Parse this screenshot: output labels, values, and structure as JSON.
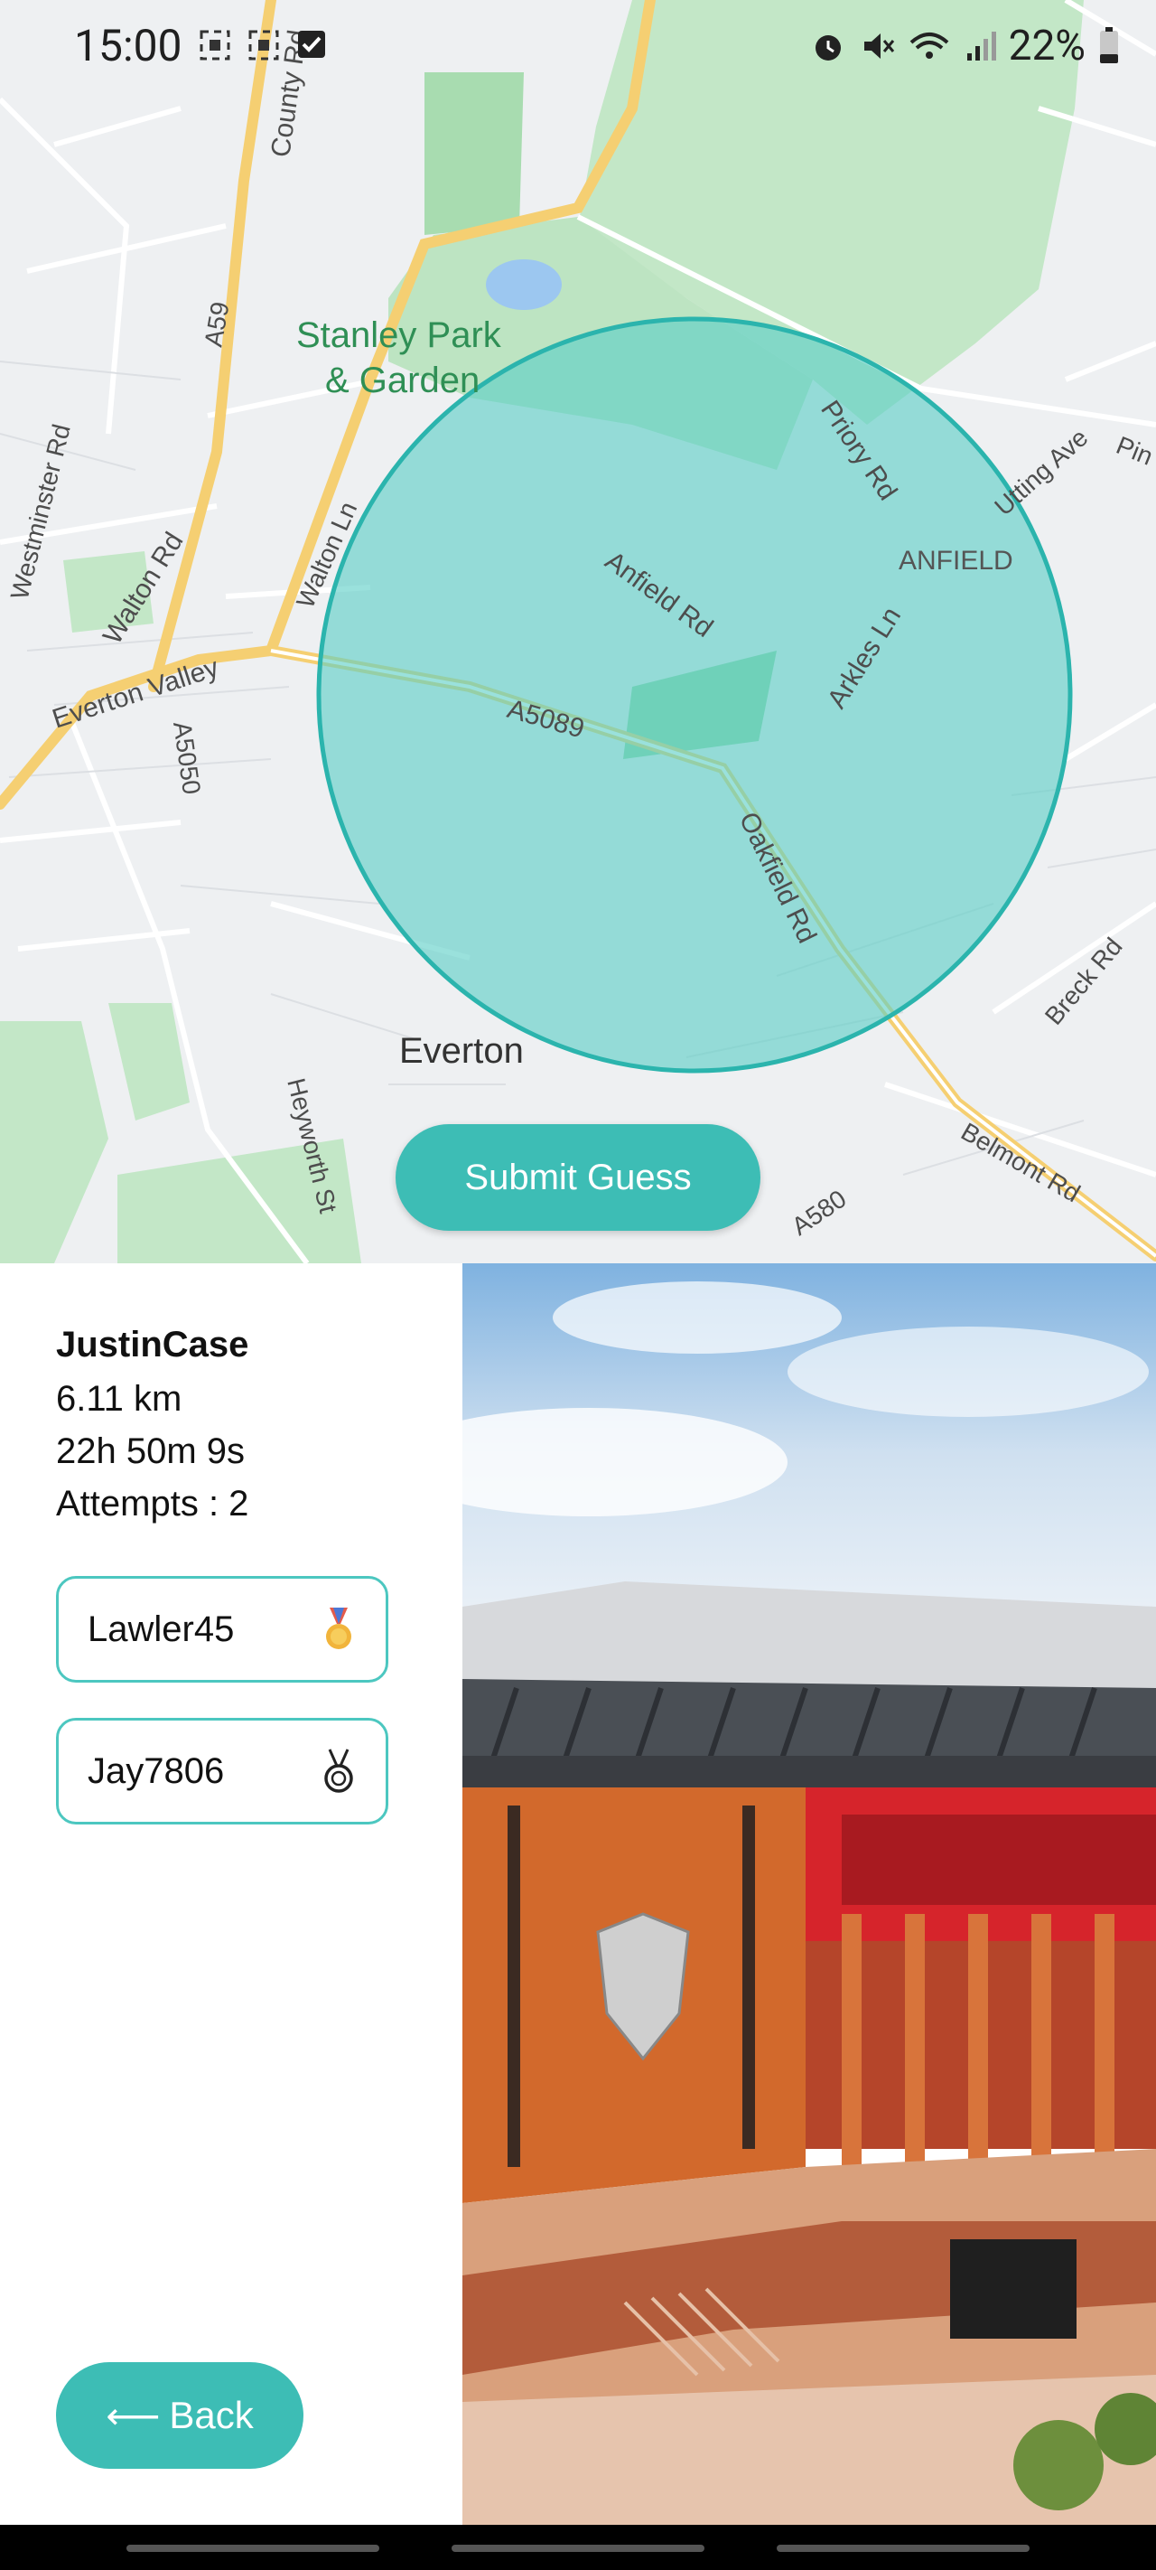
{
  "status_bar": {
    "time": "15:00",
    "battery": "22%",
    "icons": [
      "screenshot-icon",
      "screenshot-icon",
      "checkbox-icon",
      "alarm-icon",
      "mute-icon",
      "wifi-icon",
      "signal-icon",
      "battery-icon"
    ]
  },
  "map": {
    "labels": {
      "stanley_park_1": "Stanley Park",
      "stanley_park_2": "& Garden",
      "anfield": "ANFIELD",
      "everton": "Everton",
      "county_rd": "County Rd",
      "a59": "A59",
      "westminster_rd": "Westminster Rd",
      "walton_rd": "Walton Rd",
      "walton_ln": "Walton Ln",
      "everton_valley": "Everton Valley",
      "a5050": "A5050",
      "a5089": "A5089",
      "anfield_rd": "Anfield Rd",
      "priory_rd": "Priory Rd",
      "arkles_ln": "Arkles Ln",
      "utting_ave": "Utting Ave",
      "pin": "Pin",
      "oakfield_rd": "Oakfield Rd",
      "breck_rd": "Breck Rd",
      "belmont_rd": "Belmont Rd",
      "a580": "A580",
      "heyworth_st": "Heyworth St"
    },
    "colors": {
      "circle_fill": "#5ccfc7",
      "circle_stroke": "#2bb4ad",
      "park": "#bfe5c4",
      "major_road": "#f6d27a"
    }
  },
  "submit_button": {
    "label": "Submit Guess"
  },
  "player": {
    "name": "JustinCase",
    "distance": "6.11 km",
    "time": "22h 50m 9s",
    "attempts": "Attempts : 2"
  },
  "leaderboard": [
    {
      "name": "Lawler45",
      "icon": "gold-medal-icon"
    },
    {
      "name": "Jay7806",
      "icon": "silver-medal-icon"
    }
  ],
  "back_button": {
    "arrow": "⟵",
    "label": "Back"
  },
  "theme": {
    "accent": "#3dbdb5"
  }
}
